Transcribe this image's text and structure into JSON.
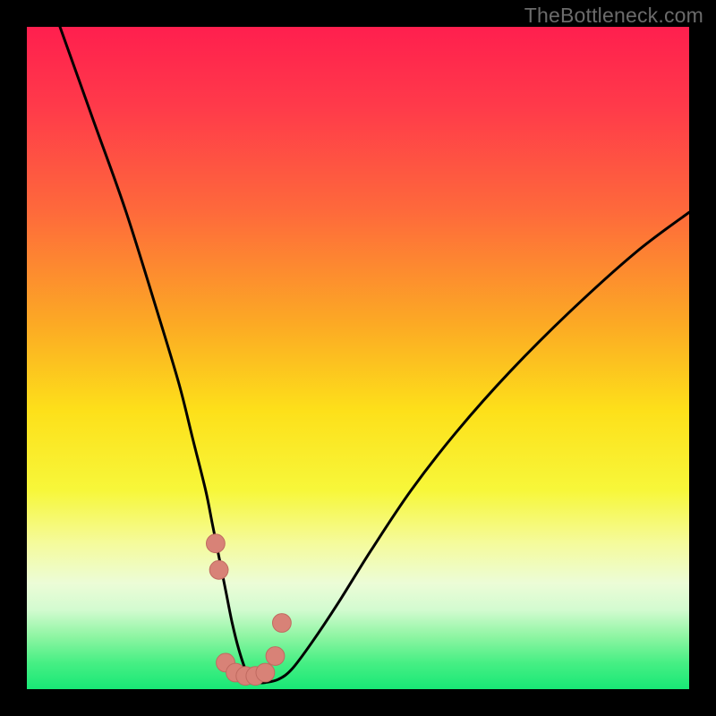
{
  "watermark": {
    "text": "TheBottleneck.com"
  },
  "colors": {
    "black": "#000000",
    "curve": "#000000",
    "marker_fill": "#d88277",
    "marker_stroke": "#c06a60",
    "gradient_stops": [
      {
        "offset": "0%",
        "color": "#ff1f4e"
      },
      {
        "offset": "12%",
        "color": "#ff3a4a"
      },
      {
        "offset": "28%",
        "color": "#fe6a3b"
      },
      {
        "offset": "45%",
        "color": "#fcaa24"
      },
      {
        "offset": "58%",
        "color": "#fde01a"
      },
      {
        "offset": "70%",
        "color": "#f7f73a"
      },
      {
        "offset": "78%",
        "color": "#f5fb9c"
      },
      {
        "offset": "84%",
        "color": "#ecfcd7"
      },
      {
        "offset": "88%",
        "color": "#d3fbd0"
      },
      {
        "offset": "92%",
        "color": "#8ff5a3"
      },
      {
        "offset": "96%",
        "color": "#47ef84"
      },
      {
        "offset": "100%",
        "color": "#18e876"
      }
    ]
  },
  "chart_data": {
    "type": "line",
    "title": "",
    "xlabel": "",
    "ylabel": "",
    "xlim": [
      0,
      100
    ],
    "ylim": [
      0,
      100
    ],
    "series": [
      {
        "name": "bottleneck-curve",
        "x": [
          5,
          10,
          15,
          20,
          23,
          25,
          27,
          28,
          29,
          30,
          31,
          32,
          33,
          34,
          35,
          36,
          38,
          40,
          43,
          47,
          52,
          58,
          65,
          73,
          82,
          92,
          100
        ],
        "values": [
          100,
          86,
          72,
          56,
          46,
          38,
          30,
          25,
          20,
          15,
          10,
          6,
          3,
          1.5,
          1,
          1,
          1.5,
          3,
          7,
          13,
          21,
          30,
          39,
          48,
          57,
          66,
          72
        ],
        "comment": "x in % of plot width, values are height-above-bottom in % (0 = bottom/green, 100 = top/red).  Estimated from pixels."
      }
    ],
    "markers": {
      "name": "highlighted-points",
      "x": [
        28.5,
        29.0,
        30.0,
        31.5,
        33.0,
        34.5,
        36.0,
        37.5,
        38.5
      ],
      "values": [
        22.0,
        18.0,
        4.0,
        2.5,
        2.0,
        2.0,
        2.5,
        5.0,
        10.0
      ],
      "radius_pct": 1.4
    }
  }
}
